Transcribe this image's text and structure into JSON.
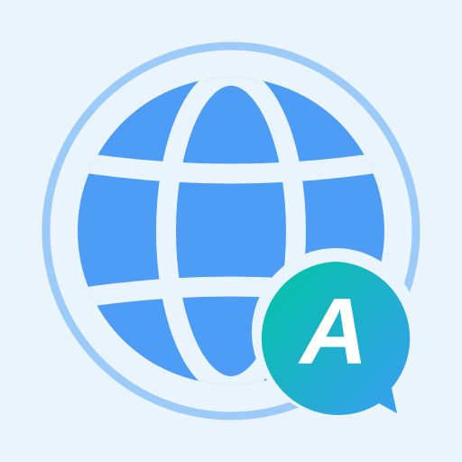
{
  "icon": {
    "name": "translate-app-icon",
    "parts": [
      "globe-icon",
      "speech-bubble-icon"
    ],
    "badge_letter": "A"
  },
  "colors": {
    "background": "#eaf4fd",
    "globe_outer_ring": "#9ccbfa",
    "globe_fill": "#4d9cf6",
    "globe_lines": "#eaf4fd",
    "bubble_gradient_start": "#00c4a3",
    "bubble_gradient_end": "#3a9ef2",
    "bubble_letter": "#ffffff"
  }
}
